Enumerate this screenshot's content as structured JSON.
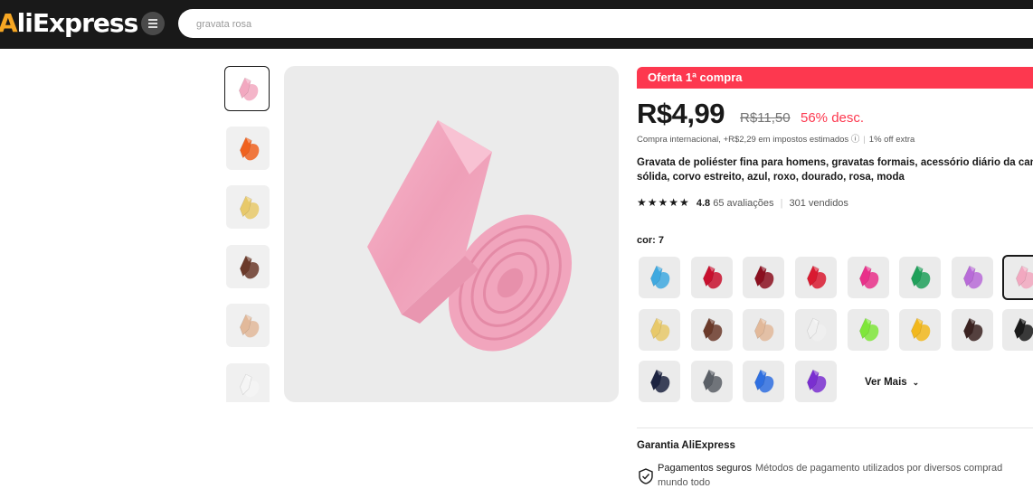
{
  "header": {
    "logo_a": "A",
    "logo_rest": "liExpress",
    "search_value": "gravata rosa"
  },
  "thumbnails": [
    {
      "color": "#f2a8c0",
      "name": "pink"
    },
    {
      "color": "#f0621e",
      "name": "orange"
    },
    {
      "color": "#e8c96a",
      "name": "gold"
    },
    {
      "color": "#6b3a2a",
      "name": "brown"
    },
    {
      "color": "#e2b99a",
      "name": "beige"
    },
    {
      "color": "#f5f5f5",
      "name": "white"
    }
  ],
  "product": {
    "offer_badge": "Oferta 1ª compra",
    "price": "R$4,99",
    "old_price": "R$11,50",
    "discount": "56% desc.",
    "tax_note": "Compra internacional, +R$2,29 em impostos estimados ⓘ",
    "extra_off": "1% off extra",
    "title_line1": "Gravata de poliéster fina para homens, gravatas formais, acessório diário da cam",
    "title_line2": "sólida, corvo estreito, azul, roxo, dourado, rosa, moda",
    "stars": "★★★★★",
    "rating": "4.8",
    "reviews": "65 avaliações",
    "sold": "301 vendidos",
    "color_label": "cor: 7"
  },
  "swatches": [
    {
      "color": "#3fa9e0"
    },
    {
      "color": "#c8102e"
    },
    {
      "color": "#8b0f1f"
    },
    {
      "color": "#d91a30"
    },
    {
      "color": "#e9308a"
    },
    {
      "color": "#1fa05a"
    },
    {
      "color": "#b86bd8"
    },
    {
      "color": "#f2a8c0"
    },
    {
      "color": "#e8c96a"
    },
    {
      "color": "#6b3a2a"
    },
    {
      "color": "#e2b99a"
    },
    {
      "color": "#f0f0f0"
    },
    {
      "color": "#7fe63a"
    },
    {
      "color": "#f2b81d"
    },
    {
      "color": "#3a2220"
    },
    {
      "color": "#1a1a1a"
    },
    {
      "color": "#1c2340"
    },
    {
      "color": "#5a5f66"
    },
    {
      "color": "#2f6fe0"
    },
    {
      "color": "#7a2fd0"
    }
  ],
  "ver_mais": "Ver Mais",
  "guarantee": {
    "title": "Garantia AliExpress",
    "pay_title": "Pagamentos seguros",
    "pay_desc": "Métodos de pagamento utilizados por diversos comprad",
    "pay_line2": "mundo todo"
  }
}
